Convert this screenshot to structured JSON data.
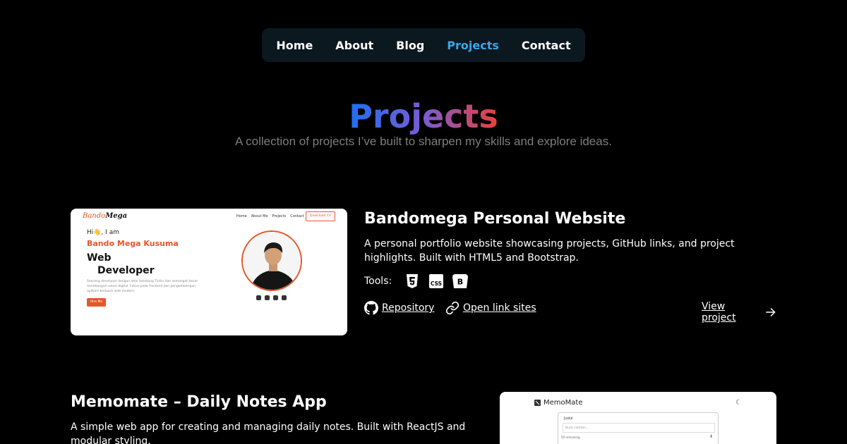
{
  "nav": {
    "items": [
      {
        "label": "Home",
        "active": false
      },
      {
        "label": "About",
        "active": false
      },
      {
        "label": "Blog",
        "active": false
      },
      {
        "label": "Projects",
        "active": true
      },
      {
        "label": "Contact",
        "active": false
      }
    ],
    "active_color": "#3ba7e6"
  },
  "header": {
    "title": "Projects",
    "subtitle": "A collection of projects I’ve built to sharpen my skills and explore ideas."
  },
  "projects": [
    {
      "title": "Bandomega Personal Website",
      "description": "A personal portfolio website showcasing projects, GitHub links, and project highlights. Built with HTML5 and Bootstrap.",
      "tools_label": "Tools:",
      "tools": [
        "html5-icon",
        "css-icon",
        "bootstrap-icon"
      ],
      "repo_label": "Repository",
      "site_label": "Open link sites",
      "view_label": "View project",
      "thumbnail": {
        "logo_a": "Bando",
        "logo_b": "Mega",
        "menu": [
          "Home",
          "About Me",
          "Projects",
          "Contact"
        ],
        "cv_button": "Download CV",
        "greeting": "Hi👋, I am",
        "name": "Bando Mega Kusuma",
        "role_1": "Web",
        "role_2": "Developer",
        "blurb": "Seorang developer dengan latar belakang Tiniks dan semangat besar membangun solusi digital. Fokus pada frontend dan pengembangan aplikasi berbasis web modern.",
        "hire_button": "Hire Me"
      }
    },
    {
      "title": "Memomate – Daily Notes App",
      "description": "A simple web app for creating and managing daily notes. Built with ReactJS and modular styling.",
      "thumbnail": {
        "logo": "MemoMate",
        "field_label": "Judul",
        "placeholder": "Buat catatan...",
        "remaining": "50 remaining"
      }
    }
  ]
}
